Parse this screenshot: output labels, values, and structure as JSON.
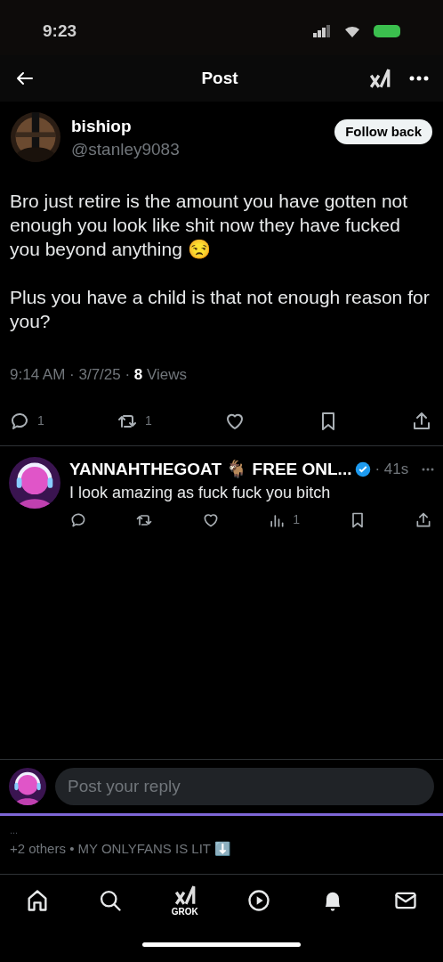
{
  "status_bar": {
    "time": "9:23"
  },
  "header": {
    "title": "Post"
  },
  "post": {
    "author": {
      "name": "bishiop",
      "handle": "@stanley9083"
    },
    "follow_button": "Follow back",
    "paragraphs": [
      "Bro just retire is the amount you have gotten not enough you look like shit now they have fucked you beyond anything 😒",
      "Plus you have a child is that not enough reason for you?"
    ],
    "meta": "9:14 AM · 3/7/25 · **8** Views",
    "actions": [
      {
        "kind": "reply",
        "count": "1"
      },
      {
        "kind": "repost",
        "count": "1"
      },
      {
        "kind": "like"
      },
      {
        "kind": "bookmark"
      },
      {
        "kind": "share"
      }
    ]
  },
  "replies": [
    {
      "name": "YANNAHTHEGOAT 🐐 FREE ONL...",
      "verified": true,
      "time": "· 41s",
      "text": "I look amazing as fuck fuck you bitch",
      "actions": [
        {
          "kind": "reply"
        },
        {
          "kind": "repost"
        },
        {
          "kind": "like"
        },
        {
          "kind": "views",
          "count": "1"
        },
        {
          "kind": "bookmark"
        },
        {
          "kind": "share"
        }
      ]
    }
  ],
  "composer": {
    "placeholder": "Post your reply"
  },
  "participants": {
    "more": "...",
    "text": "+2 others • MY ONLYFANS IS LIT ⬇️"
  },
  "bottom_nav": [
    {
      "kind": "home"
    },
    {
      "kind": "search"
    },
    {
      "kind": "grok",
      "label": "GROK"
    },
    {
      "kind": "video"
    },
    {
      "kind": "notifications"
    },
    {
      "kind": "messages"
    }
  ]
}
